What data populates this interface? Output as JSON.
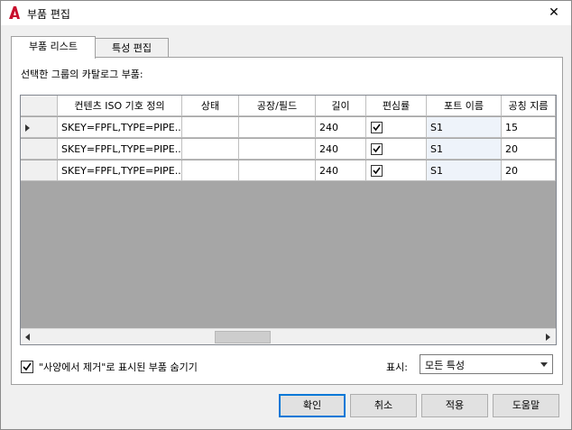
{
  "window": {
    "title": "부품 편집",
    "close_glyph": "✕"
  },
  "tabs": [
    {
      "label": "부품 리스트",
      "active": true
    },
    {
      "label": "특성 편집",
      "active": false
    }
  ],
  "panel": {
    "section_label": "선택한 그룹의 카탈로그 부품:"
  },
  "grid": {
    "columns": [
      "컨텐츠 ISO 기호 정의",
      "상태",
      "공장/필드",
      "길이",
      "편심률",
      "포트 이름",
      "공칭 지름"
    ],
    "rows": [
      {
        "iso": "SKEY=FPFL,TYPE=PIPE...",
        "status": "",
        "field": "",
        "length": "240",
        "eccentric": true,
        "port": "S1",
        "diameter": "15",
        "current": true
      },
      {
        "iso": "SKEY=FPFL,TYPE=PIPE...",
        "status": "",
        "field": "",
        "length": "240",
        "eccentric": true,
        "port": "S1",
        "diameter": "20",
        "current": false
      },
      {
        "iso": "SKEY=FPFL,TYPE=PIPE...",
        "status": "",
        "field": "",
        "length": "240",
        "eccentric": true,
        "port": "S1",
        "diameter": "20",
        "current": false
      }
    ]
  },
  "hide_removed": {
    "checked": true,
    "label": "\"사양에서 제거\"로 표시된 부품 숨기기"
  },
  "display": {
    "label": "표시:",
    "selected": "모든 특성"
  },
  "buttons": {
    "ok": "확인",
    "cancel": "취소",
    "apply": "적용",
    "help": "도움말"
  },
  "colors": {
    "app_icon": "#c8102e",
    "grid_empty": "#a6a6a6",
    "default_button_border": "#0078d7"
  }
}
